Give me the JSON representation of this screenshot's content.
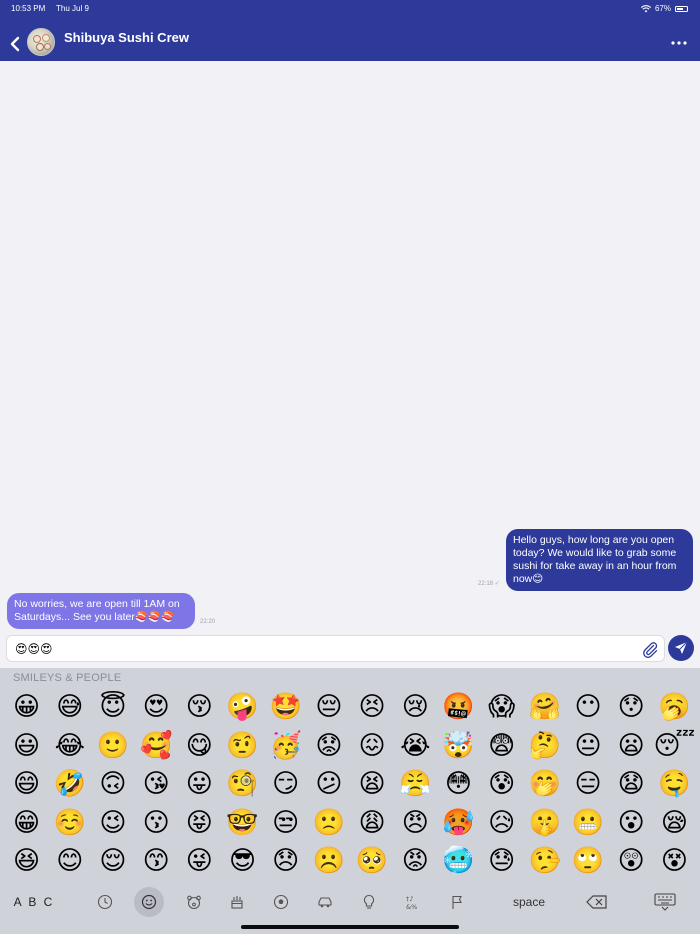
{
  "status": {
    "time": "10:53 PM",
    "date": "Thu Jul 9",
    "battery": "67%"
  },
  "header": {
    "title": "Shibuya Sushi Crew"
  },
  "messages": {
    "outgoing": {
      "text": "Hello guys, how long are you open today? We would like to grab some sushi for take away in an hour from now😊",
      "time": "22:18"
    },
    "incoming": {
      "text": "No worries, we are open till 1AM on Saturdays... See you later🍣🍣🍣",
      "time": "22:20"
    }
  },
  "composer": {
    "value": "😍😍😍"
  },
  "keyboard": {
    "section_label": "SMILEYS & PEOPLE",
    "abc_label": "A B C",
    "space_label": "space",
    "emojis": [
      "😀",
      "😅",
      "😇",
      "😍",
      "😚",
      "🤪",
      "🤩",
      "😔",
      "😣",
      "😢",
      "🤬",
      "😱",
      "🤗",
      "😶",
      "😯",
      "🥱",
      "😃",
      "😂",
      "🙂",
      "🥰",
      "😋",
      "🤨",
      "🥳",
      "😟",
      "😖",
      "😭",
      "🤯",
      "😨",
      "🤔",
      "😐",
      "😦",
      "😴",
      "😄",
      "🤣",
      "🙃",
      "😘",
      "😛",
      "🧐",
      "😏",
      "😕",
      "😫",
      "😤",
      "😳",
      "😰",
      "🤭",
      "😑",
      "😧",
      "🤤",
      "😁",
      "☺️",
      "😉",
      "😗",
      "😝",
      "🤓",
      "😒",
      "🙁",
      "😩",
      "😠",
      "🥵",
      "😥",
      "🤫",
      "😬",
      "😮",
      "😪",
      "😆",
      "😊",
      "😌",
      "😙",
      "😜",
      "😎",
      "😞",
      "☹️",
      "🥺",
      "😡",
      "🥶",
      "😓",
      "🤥",
      "🙄",
      "😲",
      "😵"
    ]
  }
}
